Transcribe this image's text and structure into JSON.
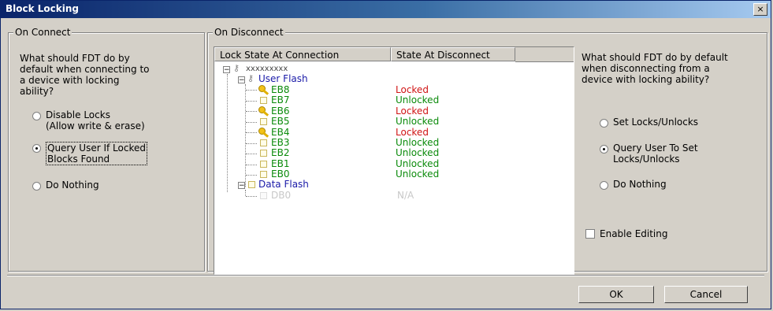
{
  "window": {
    "title": "Block Locking",
    "close_glyph": "×"
  },
  "on_connect": {
    "label": "On Connect",
    "prompt_lines": [
      "What should FDT do by",
      "default when connecting to",
      "a device with locking",
      "ability?"
    ],
    "options": [
      {
        "lines": [
          "Disable Locks",
          "(Allow write & erase)"
        ],
        "selected": false
      },
      {
        "lines": [
          "Query User If Locked",
          "Blocks Found"
        ],
        "selected": true
      },
      {
        "lines": [
          "Do Nothing"
        ],
        "selected": false
      }
    ]
  },
  "on_disconnect": {
    "label": "On Disconnect",
    "columns": [
      "Lock State At Connection",
      "State At Disconnect"
    ],
    "root": "xxxxxxxxx",
    "groups": [
      {
        "name": "User Flash",
        "blocks": [
          {
            "name": "EB8",
            "icon": "key-icon",
            "state": "Locked"
          },
          {
            "name": "EB7",
            "icon": "block-icon",
            "state": "Unlocked"
          },
          {
            "name": "EB6",
            "icon": "key-icon",
            "state": "Locked"
          },
          {
            "name": "EB5",
            "icon": "block-icon",
            "state": "Unlocked"
          },
          {
            "name": "EB4",
            "icon": "key-icon",
            "state": "Locked"
          },
          {
            "name": "EB3",
            "icon": "block-icon",
            "state": "Unlocked"
          },
          {
            "name": "EB2",
            "icon": "block-icon",
            "state": "Unlocked"
          },
          {
            "name": "EB1",
            "icon": "block-icon",
            "state": "Unlocked"
          },
          {
            "name": "EB0",
            "icon": "block-icon",
            "state": "Unlocked"
          }
        ]
      },
      {
        "name": "Data Flash",
        "blocks": [
          {
            "name": "DB0",
            "icon": "block-icon",
            "state": "N/A"
          }
        ]
      }
    ],
    "prompt_lines": [
      "What should FDT do by default",
      "when disconnecting from a",
      "device with locking ability?"
    ],
    "options": [
      {
        "lines": [
          "Set Locks/Unlocks"
        ],
        "selected": false
      },
      {
        "lines": [
          "Query User To Set",
          "Locks/Unlocks"
        ],
        "selected": true
      },
      {
        "lines": [
          "Do Nothing"
        ],
        "selected": false
      }
    ],
    "enable_editing": {
      "label": "Enable Editing",
      "checked": false
    }
  },
  "buttons": {
    "ok": "OK",
    "cancel": "Cancel"
  },
  "colors": {
    "group": "#1a1aa8",
    "unlocked": "#0a8a0a",
    "locked": "#d01414",
    "disabled": "#c8c8c8",
    "titlebar": "#0a246a"
  }
}
